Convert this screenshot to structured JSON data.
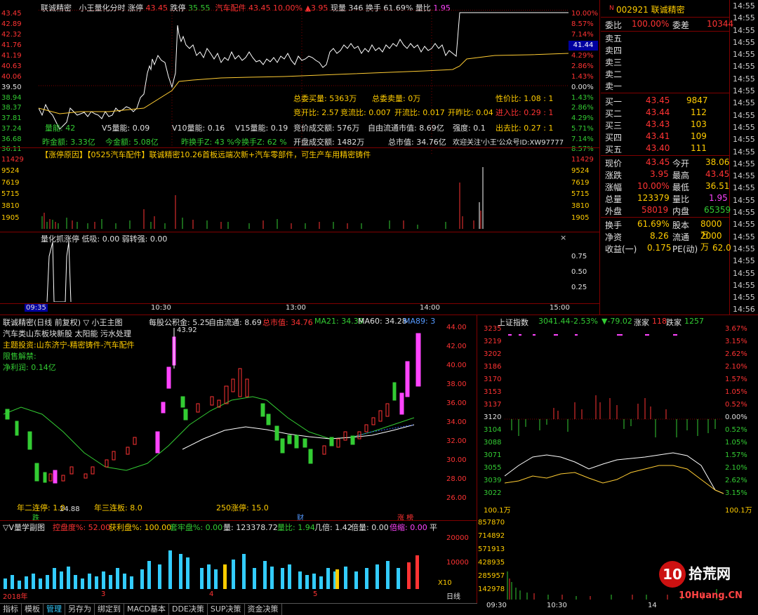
{
  "intraday": {
    "header": {
      "name": "联诚精密",
      "mode": "小王量化分时",
      "zt_label": "涨停",
      "zt_value": "43.45",
      "dt_label": "跌停",
      "dt_value": "35.55",
      "sector": "汽车配件",
      "price": "43.45",
      "pct": "10.00%",
      "change": "▲3.95",
      "now_label": "现量",
      "now_value": "346",
      "hs_label": "换手",
      "hs_value": "61.69%",
      "lb_label": "量比",
      "lb_value": "1.95"
    },
    "price_axis": [
      "43.45",
      "42.89",
      "42.32",
      "41.76",
      "41.19",
      "40.63",
      "40.06",
      "39.50",
      "38.94",
      "38.37",
      "37.81",
      "37.24",
      "36.68",
      "36.11"
    ],
    "pct_axis": [
      "10.00%",
      "8.57%",
      "7.14%",
      "5.71%",
      "4.29%",
      "2.86%",
      "1.43%",
      "0.00%",
      "1.43%",
      "2.86%",
      "4.29%",
      "5.71%",
      "7.14%",
      "8.57%"
    ],
    "cur_price_tag": "41.44",
    "info1": {
      "zwm": "总委买量: 5363万",
      "zwmc": "总委卖量: 0万",
      "xjb": "性价比: 1.08 : 1"
    },
    "info2": {
      "jkb": "竞开比: 2.57",
      "jlb": "竞流比: 0.007",
      "klb": "开流比: 0.017",
      "kzb": "开昨比: 0.04",
      "jcb": "进入比: 0.29 : 1"
    },
    "info3": {
      "lr": "量能: 42",
      "v5": "V5量能: 0.09",
      "v10": "V10量能: 0.16",
      "v15": "V15量能: 0.19",
      "jjcj": "竞价成交额: 576万",
      "zyltsz": "自由流通市值: 8.69亿",
      "qd": "强度: 0.1",
      "ccb": "出去比: 0.27 : 1"
    },
    "info4": {
      "zje": "昨金额: 3.33亿",
      "jje": "今金额: 5.08亿",
      "zhs": "昨换手Z: 43 %",
      "jhs": "今换手Z: 62 %",
      "kpcj": "开盘成交额: 1482万",
      "zsz": "总市值: 34.76亿",
      "gz": "欢迎关注'小王'公众号ID:XW97777"
    },
    "reason": "【涨停原因】【0525汽车配件】联诚精密10.26首板远端次新+汽车零部件，可生产车用精密铸件",
    "vol_axis": [
      "11429",
      "9524",
      "7619",
      "5715",
      "3810",
      "1905"
    ],
    "sub_title": "量化抓涨停  低吸: 0.00  弱转强: 0.00",
    "sub_axis": [
      "0.75",
      "0.50",
      "0.25"
    ],
    "time_axis": [
      "09:35",
      "10:30",
      "13:00",
      "14:00",
      "15:00"
    ],
    "time_start": "09"
  },
  "quote": {
    "code": "002921",
    "name": "联诚精密",
    "wb_label": "委比",
    "wb": "100.00%",
    "wc_label": "委差",
    "wc": "10344",
    "asks": [
      "卖五",
      "卖四",
      "卖三",
      "卖二",
      "卖一"
    ],
    "bids": [
      {
        "l": "买一",
        "p": "43.45",
        "v": "9847"
      },
      {
        "l": "买二",
        "p": "43.44",
        "v": "112"
      },
      {
        "l": "买三",
        "p": "43.43",
        "v": "103"
      },
      {
        "l": "买四",
        "p": "43.41",
        "v": "109"
      },
      {
        "l": "买五",
        "p": "43.40",
        "v": "111"
      }
    ],
    "stats": [
      {
        "l1": "现价",
        "v1": "43.45",
        "l2": "今开",
        "v2": "38.06"
      },
      {
        "l1": "涨跌",
        "v1": "3.95",
        "l2": "最高",
        "v2": "43.45"
      },
      {
        "l1": "涨幅",
        "v1": "10.00%",
        "l2": "最低",
        "v2": "36.51"
      },
      {
        "l1": "总量",
        "v1": "123379",
        "l2": "量比",
        "v2": "1.95"
      },
      {
        "l1": "外盘",
        "v1": "58019",
        "l2": "内盘",
        "v2": "65359"
      }
    ],
    "stats2": [
      {
        "l1": "换手",
        "v1": "61.69%",
        "l2": "股本",
        "v2": "8000万"
      },
      {
        "l1": "净资",
        "v1": "8.26",
        "l2": "流通",
        "v2": "2000万"
      },
      {
        "l1": "收益(一)",
        "v1": "0.175",
        "l2": "PE(动)",
        "v2": "62.0"
      }
    ]
  },
  "ticks": [
    "14:55",
    "14:55",
    "14:55",
    "14:55",
    "14:55",
    "14:55",
    "14:55",
    "14:55",
    "14:55",
    "14:55",
    "14:55",
    "14:55",
    "14:55",
    "14:55",
    "14:55",
    "14:55",
    "14:55",
    "14:55",
    "14:55",
    "14:55",
    "14:55",
    "14:55",
    "14:55",
    "14:55",
    "14:55",
    "14:56"
  ],
  "daily": {
    "title": "联诚精密(日线 前复权) ▽ 小王主图",
    "indicators": {
      "mg": "每股公积金: 5.25",
      "zy": "自由流通: 8.69",
      "zsz": "总市值: 34.76",
      "ma21": "MA21: 34.39",
      "ma60": "MA60: 34.28",
      "ma89": "MA89: 3"
    },
    "notes": [
      "汽车类山东板块新股 太阳能 污水处理",
      "主题投资:山东济宁-精密铸件-汽车配件",
      "限售解禁:",
      "净利润: 0.14亿"
    ],
    "high_label": "43.92",
    "low_label": "24.88",
    "stats": {
      "n2": "年二连停: 1.0",
      "n3": "年三连板: 8.0",
      "zt250": "250涨停: 15.0"
    },
    "marks": {
      "die": "跌",
      "cai": "财",
      "zt": "涨 榜"
    },
    "price_axis": [
      "44.00",
      "42.00",
      "40.00",
      "38.00",
      "36.00",
      "34.00",
      "32.00",
      "30.00",
      "28.00",
      "26.00"
    ],
    "vol_title": "▽V量学副图",
    "vol_ind": {
      "kp": "控盘度%: 52.00",
      "hl": "获利盘%: 100.00",
      "tl": "套牢盘%: 0.00",
      "l": "量: 123378.72",
      "lb": "量比: 1.94",
      "jb": "几倍: 1.42",
      "bl": "倍量: 0.00",
      "bz": "倍缩: 0.00",
      "p": "平"
    },
    "vol_axis": [
      "20000",
      "10000"
    ],
    "vol_unit": "X10",
    "dates": [
      "2018年",
      "3",
      "4",
      "5"
    ],
    "period": "日线"
  },
  "index": {
    "title": "上证指数",
    "value": "3041.44",
    "pct": "-2.53%",
    "chg": "▼-79.02",
    "zj_label": "涨家",
    "zj": "118",
    "dj_label": "跌家",
    "dj": "1257",
    "left_axis": [
      "3235",
      "3219",
      "3202",
      "3186",
      "3170",
      "3153",
      "3137",
      "3120",
      "3104",
      "3088",
      "3071",
      "3055",
      "3039",
      "3022"
    ],
    "right_axis": [
      "3.67%",
      "3.15%",
      "2.62%",
      "2.10%",
      "1.57%",
      "1.05%",
      "0.52%",
      "0.00%",
      "0.52%",
      "1.05%",
      "1.57%",
      "2.10%",
      "2.62%",
      "3.15%"
    ],
    "vol_unit": "100.1万",
    "vol_axis": [
      "857870",
      "714892",
      "571913",
      "428935",
      "285957",
      "142978"
    ],
    "time_axis": [
      "09:30",
      "10:30",
      "14"
    ]
  },
  "tabs": [
    "指标",
    "模板",
    "管理",
    "另存为",
    "绑定到",
    "MACD基本",
    "DDE决策",
    "SUP决策",
    "资金决策"
  ],
  "watermark": {
    "text": "拾荒网",
    "url": "10Huang.CN"
  }
}
